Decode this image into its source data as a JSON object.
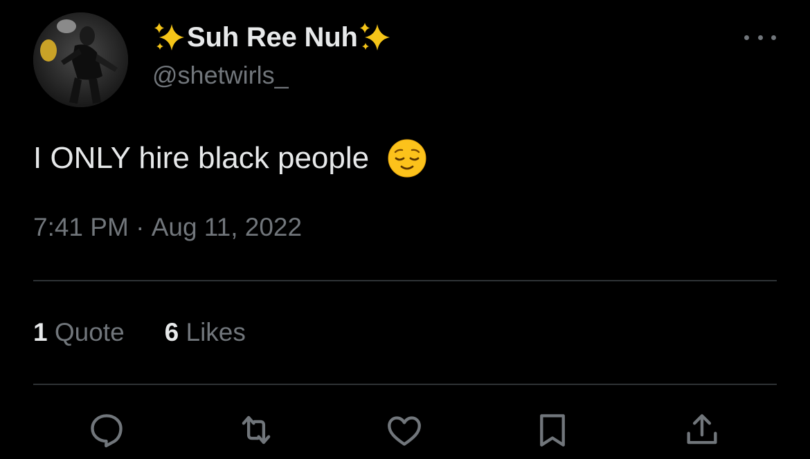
{
  "author": {
    "name_emoji_left": "✨",
    "name": "Suh Ree Nuh",
    "name_emoji_right": "✨",
    "handle": "@shetwirls_",
    "avatar_icon": "profile-photo"
  },
  "tweet": {
    "text": "I ONLY hire black people ",
    "emoji": "😌"
  },
  "timestamp": {
    "time": "7:41 PM",
    "separator": " · ",
    "date": "Aug 11, 2022"
  },
  "stats": [
    {
      "count": "1",
      "label": " Quote"
    },
    {
      "count": "6",
      "label": " Likes"
    }
  ],
  "actions": [
    {
      "icon": "reply-icon"
    },
    {
      "icon": "retweet-icon"
    },
    {
      "icon": "like-icon"
    },
    {
      "icon": "bookmark-icon"
    },
    {
      "icon": "share-icon"
    }
  ],
  "colors": {
    "background": "#000000",
    "primary_text": "#e7e9ea",
    "secondary_text": "#71767b",
    "divider": "#2f3336",
    "sparkle": "#f5c518"
  }
}
